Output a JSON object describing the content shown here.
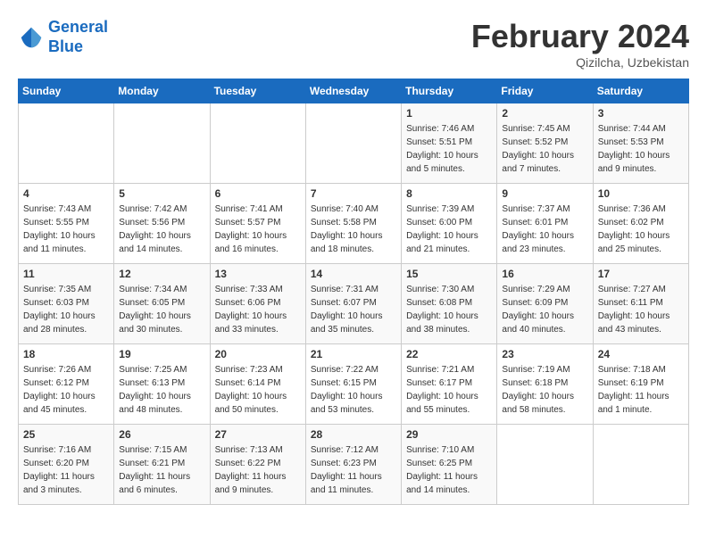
{
  "header": {
    "logo_line1": "General",
    "logo_line2": "Blue",
    "month": "February 2024",
    "location": "Qizilcha, Uzbekistan"
  },
  "weekdays": [
    "Sunday",
    "Monday",
    "Tuesday",
    "Wednesday",
    "Thursday",
    "Friday",
    "Saturday"
  ],
  "weeks": [
    [
      {
        "day": "",
        "info": ""
      },
      {
        "day": "",
        "info": ""
      },
      {
        "day": "",
        "info": ""
      },
      {
        "day": "",
        "info": ""
      },
      {
        "day": "1",
        "info": "Sunrise: 7:46 AM\nSunset: 5:51 PM\nDaylight: 10 hours\nand 5 minutes."
      },
      {
        "day": "2",
        "info": "Sunrise: 7:45 AM\nSunset: 5:52 PM\nDaylight: 10 hours\nand 7 minutes."
      },
      {
        "day": "3",
        "info": "Sunrise: 7:44 AM\nSunset: 5:53 PM\nDaylight: 10 hours\nand 9 minutes."
      }
    ],
    [
      {
        "day": "4",
        "info": "Sunrise: 7:43 AM\nSunset: 5:55 PM\nDaylight: 10 hours\nand 11 minutes."
      },
      {
        "day": "5",
        "info": "Sunrise: 7:42 AM\nSunset: 5:56 PM\nDaylight: 10 hours\nand 14 minutes."
      },
      {
        "day": "6",
        "info": "Sunrise: 7:41 AM\nSunset: 5:57 PM\nDaylight: 10 hours\nand 16 minutes."
      },
      {
        "day": "7",
        "info": "Sunrise: 7:40 AM\nSunset: 5:58 PM\nDaylight: 10 hours\nand 18 minutes."
      },
      {
        "day": "8",
        "info": "Sunrise: 7:39 AM\nSunset: 6:00 PM\nDaylight: 10 hours\nand 21 minutes."
      },
      {
        "day": "9",
        "info": "Sunrise: 7:37 AM\nSunset: 6:01 PM\nDaylight: 10 hours\nand 23 minutes."
      },
      {
        "day": "10",
        "info": "Sunrise: 7:36 AM\nSunset: 6:02 PM\nDaylight: 10 hours\nand 25 minutes."
      }
    ],
    [
      {
        "day": "11",
        "info": "Sunrise: 7:35 AM\nSunset: 6:03 PM\nDaylight: 10 hours\nand 28 minutes."
      },
      {
        "day": "12",
        "info": "Sunrise: 7:34 AM\nSunset: 6:05 PM\nDaylight: 10 hours\nand 30 minutes."
      },
      {
        "day": "13",
        "info": "Sunrise: 7:33 AM\nSunset: 6:06 PM\nDaylight: 10 hours\nand 33 minutes."
      },
      {
        "day": "14",
        "info": "Sunrise: 7:31 AM\nSunset: 6:07 PM\nDaylight: 10 hours\nand 35 minutes."
      },
      {
        "day": "15",
        "info": "Sunrise: 7:30 AM\nSunset: 6:08 PM\nDaylight: 10 hours\nand 38 minutes."
      },
      {
        "day": "16",
        "info": "Sunrise: 7:29 AM\nSunset: 6:09 PM\nDaylight: 10 hours\nand 40 minutes."
      },
      {
        "day": "17",
        "info": "Sunrise: 7:27 AM\nSunset: 6:11 PM\nDaylight: 10 hours\nand 43 minutes."
      }
    ],
    [
      {
        "day": "18",
        "info": "Sunrise: 7:26 AM\nSunset: 6:12 PM\nDaylight: 10 hours\nand 45 minutes."
      },
      {
        "day": "19",
        "info": "Sunrise: 7:25 AM\nSunset: 6:13 PM\nDaylight: 10 hours\nand 48 minutes."
      },
      {
        "day": "20",
        "info": "Sunrise: 7:23 AM\nSunset: 6:14 PM\nDaylight: 10 hours\nand 50 minutes."
      },
      {
        "day": "21",
        "info": "Sunrise: 7:22 AM\nSunset: 6:15 PM\nDaylight: 10 hours\nand 53 minutes."
      },
      {
        "day": "22",
        "info": "Sunrise: 7:21 AM\nSunset: 6:17 PM\nDaylight: 10 hours\nand 55 minutes."
      },
      {
        "day": "23",
        "info": "Sunrise: 7:19 AM\nSunset: 6:18 PM\nDaylight: 10 hours\nand 58 minutes."
      },
      {
        "day": "24",
        "info": "Sunrise: 7:18 AM\nSunset: 6:19 PM\nDaylight: 11 hours\nand 1 minute."
      }
    ],
    [
      {
        "day": "25",
        "info": "Sunrise: 7:16 AM\nSunset: 6:20 PM\nDaylight: 11 hours\nand 3 minutes."
      },
      {
        "day": "26",
        "info": "Sunrise: 7:15 AM\nSunset: 6:21 PM\nDaylight: 11 hours\nand 6 minutes."
      },
      {
        "day": "27",
        "info": "Sunrise: 7:13 AM\nSunset: 6:22 PM\nDaylight: 11 hours\nand 9 minutes."
      },
      {
        "day": "28",
        "info": "Sunrise: 7:12 AM\nSunset: 6:23 PM\nDaylight: 11 hours\nand 11 minutes."
      },
      {
        "day": "29",
        "info": "Sunrise: 7:10 AM\nSunset: 6:25 PM\nDaylight: 11 hours\nand 14 minutes."
      },
      {
        "day": "",
        "info": ""
      },
      {
        "day": "",
        "info": ""
      }
    ]
  ]
}
